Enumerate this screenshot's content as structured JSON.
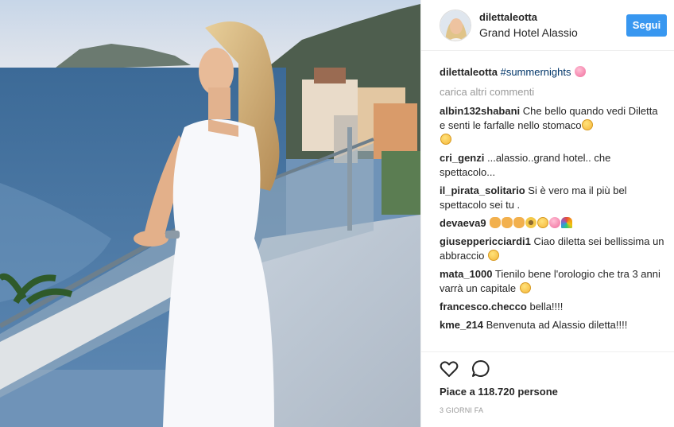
{
  "post": {
    "username": "dilettaleotta",
    "location": "Grand Hotel Alassio",
    "follow_label": "Segui",
    "caption_user": "dilettaleotta",
    "caption_hashtag": "#summernights",
    "load_more": "carica altri commenti",
    "comments": [
      {
        "user": "albin132shabani",
        "text": "Che bello quando vedi Diletta e senti le farfalle nello stomaco"
      },
      {
        "user": "cri_genzi",
        "text": "...alassio..grand hotel.. che spettacolo..."
      },
      {
        "user": "il_pirata_solitario",
        "text": "Si è vero ma il più bel spettacolo sei tu ."
      },
      {
        "user": "devaeva9",
        "text": ""
      },
      {
        "user": "giuseppericciardi1",
        "text": "Ciao diletta sei bellissima un abbraccio"
      },
      {
        "user": "mata_1000",
        "text": "Tienilo bene l'orologio che tra 3 anni varrà un capitale"
      },
      {
        "user": "francesco.checco",
        "text": "bella!!!!"
      },
      {
        "user": "kme_214",
        "text": "Benvenuta ad Alassio diletta!!!!"
      }
    ],
    "likes": "Piace a 118.720 persone",
    "time": "3 GIORNI FA",
    "icons": {
      "like": "heart-icon",
      "comment": "comment-icon"
    },
    "colors": {
      "follow_button": "#3897f0",
      "hashtag": "#003569",
      "muted": "#999999"
    }
  }
}
